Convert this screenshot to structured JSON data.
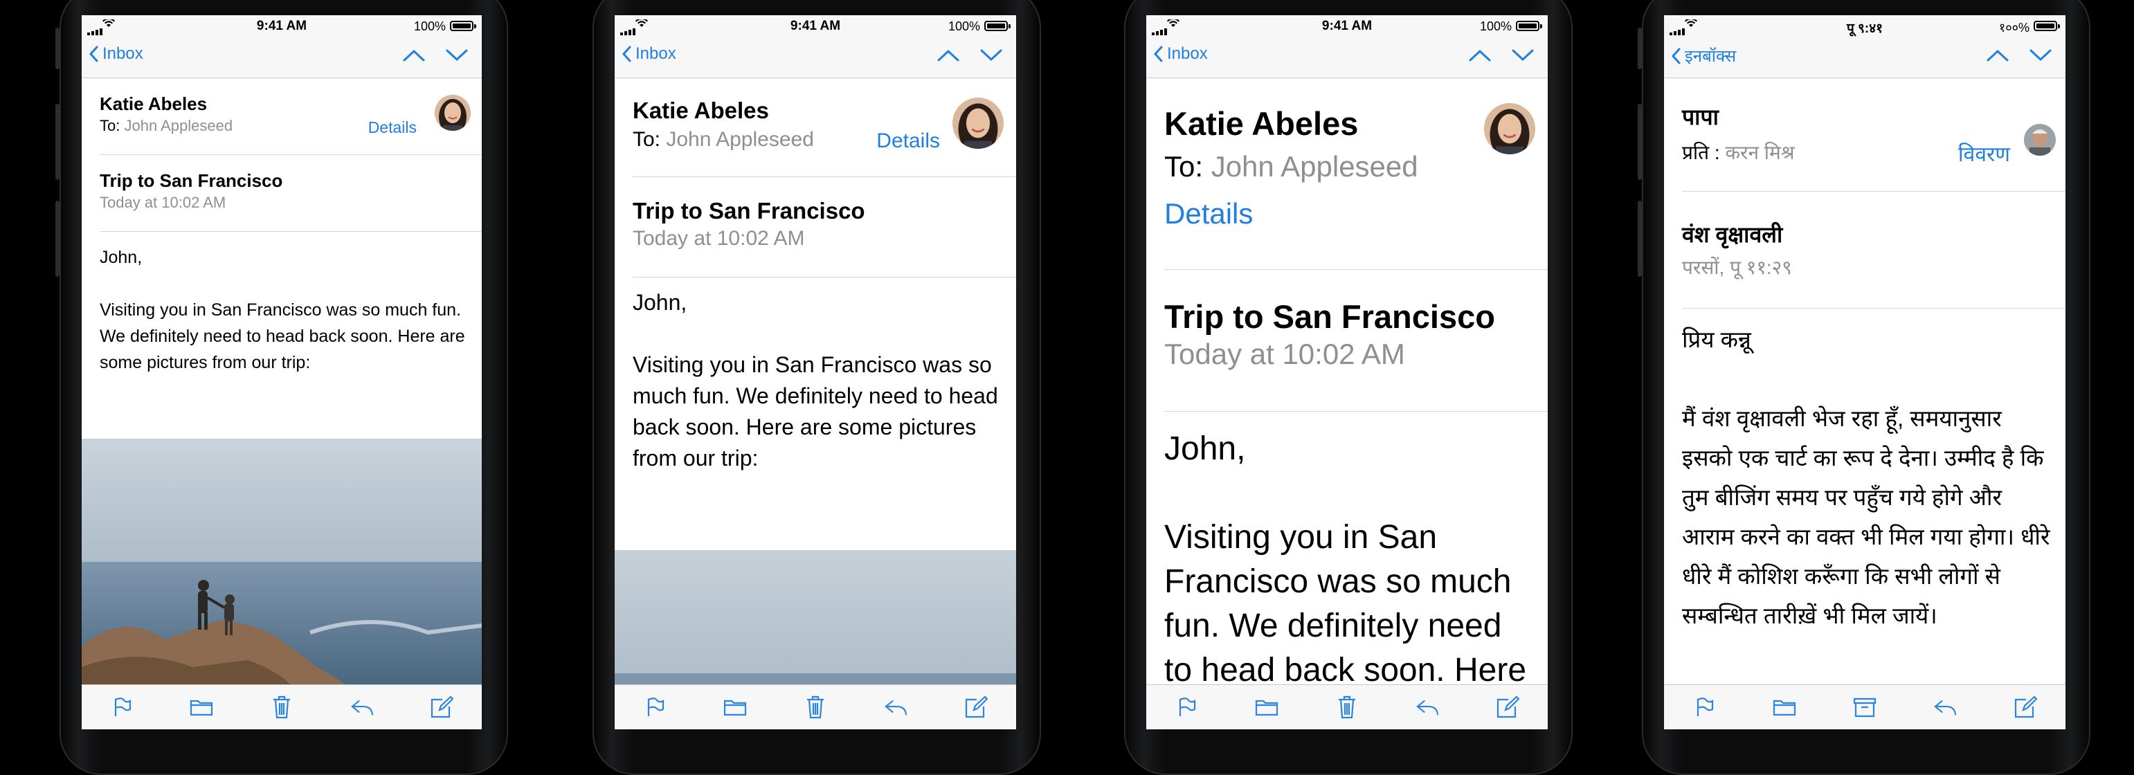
{
  "colors": {
    "accent": "#1f7fe0",
    "secondary_text": "#8e8e93",
    "bar_bg": "#f7f7f7"
  },
  "phones": [
    {
      "status": {
        "time": "9:41 AM",
        "battery": "100%"
      },
      "nav": {
        "back_label": "Inbox"
      },
      "header": {
        "sender": "Katie Abeles",
        "to_prefix": "To:",
        "recipient": "John Appleseed",
        "details_label": "Details"
      },
      "subject": "Trip to San Francisco",
      "date": "Today at 10:02 AM",
      "greeting": "John,",
      "body": "Visiting you in San Francisco was so much fun. We definitely need to head back soon. Here are some pictures from our trip:",
      "toolbar": [
        "flag-icon",
        "folder-icon",
        "trash-icon",
        "reply-icon",
        "compose-icon"
      ]
    },
    {
      "status": {
        "time": "9:41 AM",
        "battery": "100%"
      },
      "nav": {
        "back_label": "Inbox"
      },
      "header": {
        "sender": "Katie Abeles",
        "to_prefix": "To:",
        "recipient": "John Appleseed",
        "details_label": "Details"
      },
      "subject": "Trip to San Francisco",
      "date": "Today at 10:02 AM",
      "greeting": "John,",
      "body": "Visiting you in San Francisco was so much fun. We definitely need to head back soon. Here are some pictures from our trip:",
      "toolbar": [
        "flag-icon",
        "folder-icon",
        "trash-icon",
        "reply-icon",
        "compose-icon"
      ]
    },
    {
      "status": {
        "time": "9:41 AM",
        "battery": "100%"
      },
      "nav": {
        "back_label": "Inbox"
      },
      "header": {
        "sender": "Katie Abeles",
        "to_prefix": "To:",
        "recipient": "John Appleseed",
        "details_label": "Details"
      },
      "subject": "Trip to San Francisco",
      "date": "Today at 10:02 AM",
      "greeting": "John,",
      "body": "Visiting you in San Francisco was so much fun. We definitely need to head back soon. Here",
      "toolbar": [
        "flag-icon",
        "folder-icon",
        "trash-icon",
        "reply-icon",
        "compose-icon"
      ]
    },
    {
      "status": {
        "time": "पू ९:४१",
        "battery": "१००%"
      },
      "nav": {
        "back_label": "इनबॉक्स"
      },
      "header": {
        "sender": "पापा",
        "to_prefix": "प्रति :",
        "recipient": "करन मिश्र",
        "details_label": "विवरण"
      },
      "subject": "वंश वृक्षावली",
      "date": "परसों, पू ११:२९",
      "greeting": "प्रिय कन्नू",
      "body": "मैं वंश वृक्षावली भेज रहा हूँ, समयानुसार इसको एक चार्ट का रूप दे देना। उम्मीद है कि तुम बीजिंग समय पर पहुँच गये होगे और आराम करने का वक्त भी मिल गया होगा। धीरे धीरे मैं कोशिश करूँगा कि सभी लोगों से सम्बन्धित तारीख़ें भी मिल जायें।",
      "toolbar": [
        "flag-icon",
        "folder-icon",
        "archive-icon",
        "reply-icon",
        "compose-icon"
      ]
    }
  ]
}
